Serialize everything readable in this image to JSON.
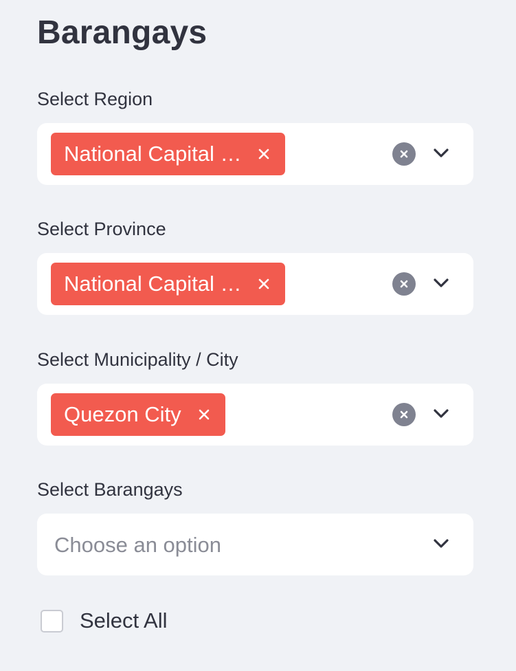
{
  "sidebar": {
    "title": "Barangays",
    "region": {
      "label": "Select Region",
      "selected_tag": "National Capital …"
    },
    "province": {
      "label": "Select Province",
      "selected_tag": "National Capital …"
    },
    "municipality": {
      "label": "Select Municipality / City",
      "selected_tag": "Quezon City"
    },
    "barangays": {
      "label": "Select Barangays",
      "placeholder": "Choose an option"
    },
    "select_all": {
      "label": "Select All",
      "checked": false
    }
  },
  "icons": {
    "tag_remove": "close-icon",
    "clear": "clear-circle-icon",
    "dropdown": "chevron-down-icon"
  },
  "colors": {
    "background": "#f0f2f6",
    "tag": "#f25b4f",
    "clear_button": "#7f8290",
    "text": "#31333f",
    "placeholder": "#8a8c96"
  }
}
